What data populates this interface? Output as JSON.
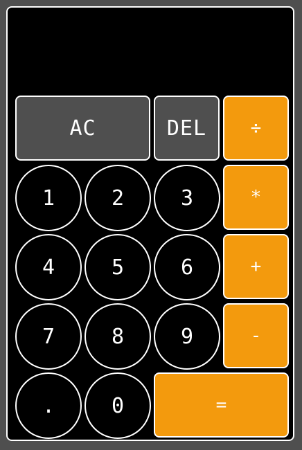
{
  "display": {
    "value": ""
  },
  "keys": {
    "clear": "AC",
    "delete": "DEL",
    "divide": "÷",
    "multiply": "*",
    "add": "+",
    "subtract": "-",
    "equals": "=",
    "decimal": ".",
    "d0": "0",
    "d1": "1",
    "d2": "2",
    "d3": "3",
    "d4": "4",
    "d5": "5",
    "d6": "6",
    "d7": "7",
    "d8": "8",
    "d9": "9"
  },
  "colors": {
    "background": "#4f4f4f",
    "panel": "#000000",
    "function_key": "#4f4f4f",
    "operator_key": "#f39a0d",
    "text": "#ffffff"
  }
}
